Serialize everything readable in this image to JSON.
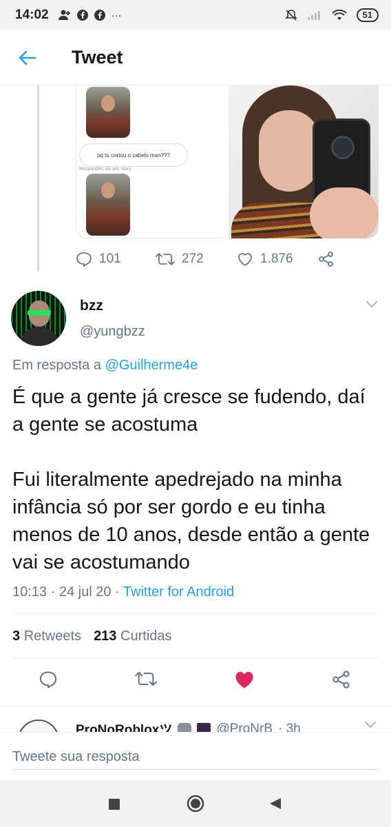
{
  "status_bar": {
    "time": "14:02",
    "battery": "51",
    "more": "···"
  },
  "header": {
    "title": "Tweet"
  },
  "previous_tweet": {
    "story_text": "pq tu cortou o cabelo man???",
    "story_meta": "Respondeu ao seu story",
    "replies": "101",
    "retweets": "272",
    "likes": "1.876"
  },
  "tweet": {
    "name": "bzz",
    "handle": "@yungbzz",
    "reply_prefix": "Em resposta a",
    "reply_mention": "@Guilherme4e",
    "paragraph_1": "É que a gente já cresce se fudendo, daí a gente se acostuma",
    "paragraph_2": "Fui literalmente apedrejado na minha infância só por ser gordo e eu tinha menos de 10 anos, desde então a gente vai se acostumando",
    "time": "10:13",
    "date": "24 jul 20",
    "source": "Twitter for Android",
    "retweet_count": "3",
    "retweet_label": "Retweets",
    "like_count": "213",
    "like_label": "Curtidas",
    "liked": true
  },
  "next_reply": {
    "name": "ProNoRobloxツ",
    "handle": "@ProNrB",
    "time": "· 3h"
  },
  "compose": {
    "placeholder": "Tweete sua resposta"
  },
  "colors": {
    "accent": "#1da1f2",
    "like": "#e0245e",
    "muted": "#657786",
    "text": "#14171a"
  },
  "icons": [
    "back-arrow-icon",
    "reply-icon",
    "retweet-icon",
    "like-icon",
    "share-icon",
    "chevron-down-icon",
    "square-icon",
    "circle-icon",
    "triangle-back-icon"
  ]
}
